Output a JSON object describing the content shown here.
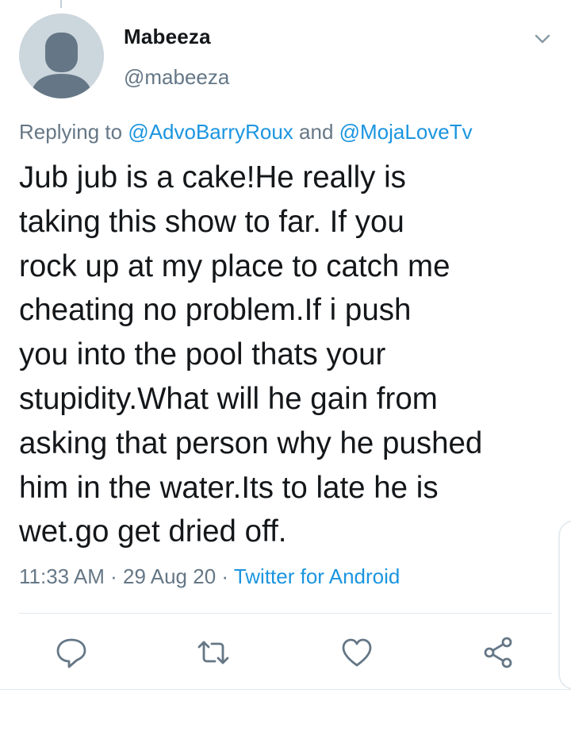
{
  "tweet": {
    "display_name": "Mabeeza",
    "handle": "@mabeeza",
    "reply": {
      "prefix": "Replying to ",
      "mention_1": "@AdvoBarryRoux",
      "joiner": " and ",
      "mention_2": "@MojaLoveTv"
    },
    "text_lines": [
      "Jub jub is a cake!He really is",
      "taking this show to far. If you",
      "rock up at my place to catch me",
      "cheating no problem.If i push",
      "you into the pool thats your",
      "stupidity.What will he gain from",
      "asking that person why he pushed",
      "him in the water.Its to late he is",
      "wet.go get dried off."
    ],
    "time": "11:33 AM",
    "separator": " · ",
    "date": "29 Aug 20",
    "source": "Twitter for Android"
  },
  "actions": {
    "reply_icon": "reply-icon",
    "retweet_icon": "retweet-icon",
    "like_icon": "heart-icon",
    "share_icon": "share-icon"
  },
  "colors": {
    "link": "#1b95e0",
    "secondary_text": "#657786",
    "primary_text": "#14171a",
    "avatar_bg": "#ccd6dd",
    "avatar_fg": "#657786"
  }
}
